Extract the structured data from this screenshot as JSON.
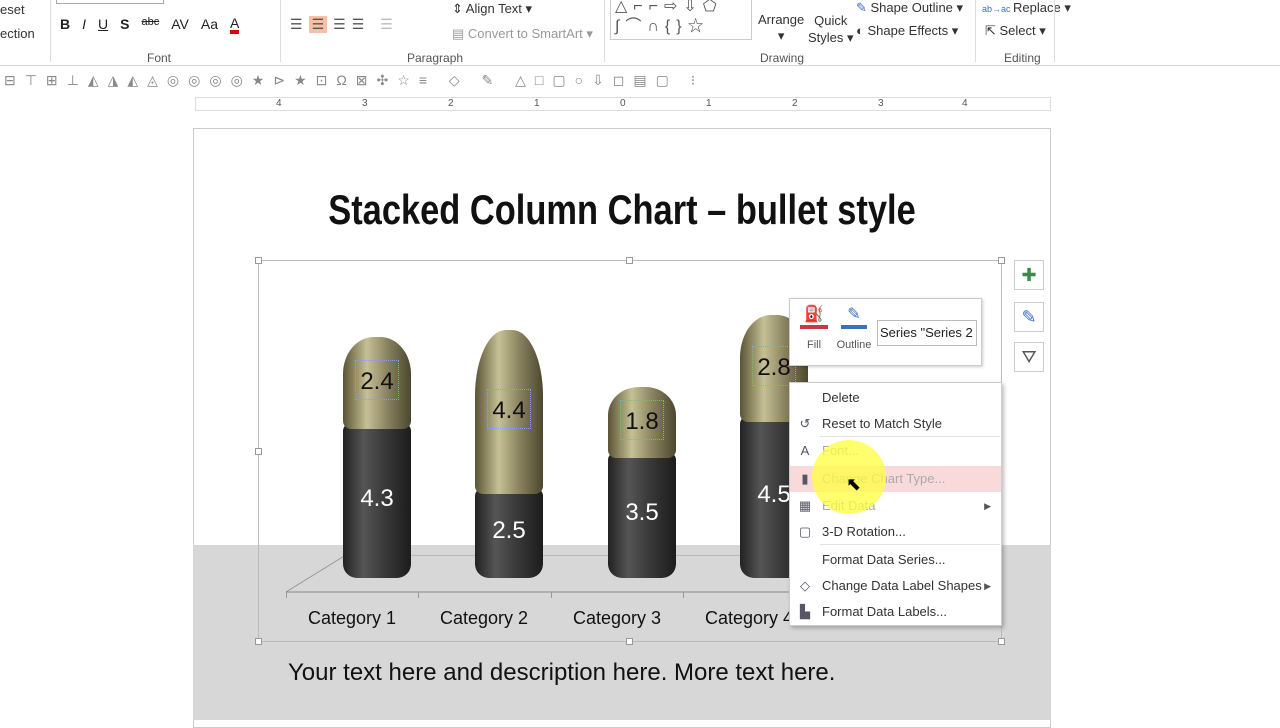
{
  "ribbon": {
    "left_cut": [
      "eset",
      "ection"
    ],
    "font_group": "Font",
    "paragraph_group": "Paragraph",
    "drawing_group": "Drawing",
    "editing_group": "Editing",
    "font_buttons": [
      "B",
      "I",
      "U",
      "S",
      "abc",
      "AV",
      "Aa",
      "A"
    ],
    "align_text": "Align Text",
    "convert_smartart": "Convert to SmartArt",
    "arrange": "Arrange",
    "quick_styles": [
      "Quick",
      "Styles"
    ],
    "shape_outline": "Shape Outline",
    "shape_effects": "Shape Effects",
    "replace": "Replace",
    "select": "Select"
  },
  "ruler": [
    "4",
    "3",
    "2",
    "1",
    "0",
    "1",
    "2",
    "3",
    "4"
  ],
  "slide": {
    "title": "Stacked Column Chart – bullet style",
    "description": "Your text here and description here. More text here."
  },
  "chart_data": {
    "type": "bar",
    "stacked": true,
    "style": "3d-bullet",
    "categories": [
      "Category 1",
      "Category 2",
      "Category 3",
      "Category 4"
    ],
    "series": [
      {
        "values": [
          4.3,
          2.5,
          3.5,
          4.5
        ],
        "color": "#3a3a3a"
      },
      {
        "values": [
          2.4,
          4.4,
          1.8,
          2.8
        ],
        "color": "#a39d74"
      }
    ],
    "data_labels": true,
    "grid": false,
    "legend": "none"
  },
  "mini_toolbar": {
    "fill": "Fill",
    "outline": "Outline",
    "series_select": "Series \"Series 2"
  },
  "context_menu": [
    {
      "label": "Delete",
      "icon": "",
      "disabled": false
    },
    {
      "label": "Reset to Match Style",
      "icon": "reset-style-icon",
      "disabled": false
    },
    {
      "label": "Font...",
      "icon": "font-icon",
      "disabled": true
    },
    {
      "label": "Change Chart Type...",
      "icon": "chart-type-icon",
      "disabled": true,
      "highlighted": true
    },
    {
      "label": "Edit Data",
      "icon": "edit-data-icon",
      "disabled": true,
      "submenu": true
    },
    {
      "label": "3-D Rotation...",
      "icon": "rotation-icon",
      "disabled": false
    },
    {
      "label": "Format Data Series...",
      "icon": "",
      "disabled": false
    },
    {
      "label": "Change Data Label Shapes",
      "icon": "label-shapes-icon",
      "disabled": false,
      "submenu": true
    },
    {
      "label": "Format Data Labels...",
      "icon": "format-labels-icon",
      "disabled": false
    }
  ],
  "side_buttons": [
    "chart-elements",
    "chart-styles",
    "chart-filters"
  ]
}
